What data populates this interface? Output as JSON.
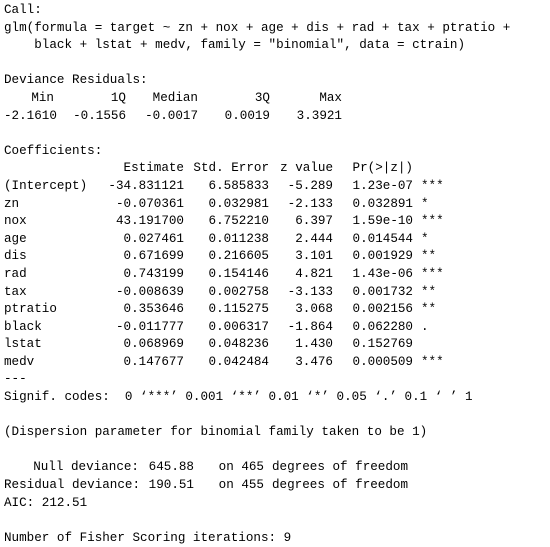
{
  "call": {
    "label": "Call:",
    "line1": "glm(formula = target ~ zn + nox + age + dis + rad + tax + ptratio +",
    "line2": "    black + lstat + medv, family = \"binomial\", data = ctrain)"
  },
  "residuals": {
    "title": "Deviance Residuals:",
    "headers": [
      "Min",
      "1Q",
      "Median",
      "3Q",
      "Max"
    ],
    "values": [
      "-2.1610",
      "-0.1556",
      "-0.0017",
      "0.0019",
      "3.3921"
    ]
  },
  "coefficients": {
    "title": "Coefficients:",
    "headers": [
      "Estimate",
      "Std. Error",
      "z value",
      "Pr(>|z|)"
    ],
    "rows": [
      {
        "name": "(Intercept)",
        "estimate": "-34.831121",
        "se": "6.585833",
        "z": "-5.289",
        "p": "1.23e-07",
        "sig": "***"
      },
      {
        "name": "zn",
        "estimate": "-0.070361",
        "se": "0.032981",
        "z": "-2.133",
        "p": "0.032891",
        "sig": "*"
      },
      {
        "name": "nox",
        "estimate": "43.191700",
        "se": "6.752210",
        "z": "6.397",
        "p": "1.59e-10",
        "sig": "***"
      },
      {
        "name": "age",
        "estimate": "0.027461",
        "se": "0.011238",
        "z": "2.444",
        "p": "0.014544",
        "sig": "*"
      },
      {
        "name": "dis",
        "estimate": "0.671699",
        "se": "0.216605",
        "z": "3.101",
        "p": "0.001929",
        "sig": "**"
      },
      {
        "name": "rad",
        "estimate": "0.743199",
        "se": "0.154146",
        "z": "4.821",
        "p": "1.43e-06",
        "sig": "***"
      },
      {
        "name": "tax",
        "estimate": "-0.008639",
        "se": "0.002758",
        "z": "-3.133",
        "p": "0.001732",
        "sig": "**"
      },
      {
        "name": "ptratio",
        "estimate": "0.353646",
        "se": "0.115275",
        "z": "3.068",
        "p": "0.002156",
        "sig": "**"
      },
      {
        "name": "black",
        "estimate": "-0.011777",
        "se": "0.006317",
        "z": "-1.864",
        "p": "0.062280",
        "sig": "."
      },
      {
        "name": "lstat",
        "estimate": "0.068969",
        "se": "0.048236",
        "z": "1.430",
        "p": "0.152769",
        "sig": ""
      },
      {
        "name": "medv",
        "estimate": "0.147677",
        "se": "0.042484",
        "z": "3.476",
        "p": "0.000509",
        "sig": "***"
      }
    ],
    "separator": "---",
    "signif": "Signif. codes:  0 ‘***’ 0.001 ‘**’ 0.01 ‘*’ 0.05 ‘.’ 0.1 ‘ ’ 1"
  },
  "dispersion": "(Dispersion parameter for binomial family taken to be 1)",
  "deviance": {
    "null_label": "Null deviance:",
    "null_value": "645.88",
    "null_on": "on 465",
    "null_df": "degrees of freedom",
    "resid_label": "Residual deviance:",
    "resid_value": "190.51",
    "resid_on": "on 455",
    "resid_df": "degrees of freedom",
    "aic": "AIC: 212.51"
  },
  "fisher": "Number of Fisher Scoring iterations: 9"
}
